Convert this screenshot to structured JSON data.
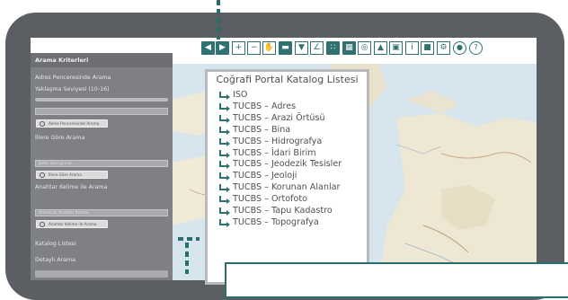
{
  "sidebar": {
    "header": "Arama Kriterleri",
    "address_label": "Adres Penceresinde Arama",
    "zoom_label": "Yaklaşma Seviyesi (10-16)",
    "address_button": "Adres Penceresinde Arama",
    "province_label": "İllere Göre Arama",
    "province_placeholder": "Şehir ismi giriniz...",
    "province_button": "İllere Göre Arama",
    "keyword_label": "Anahtar Kelime ile Arama",
    "keyword_placeholder": "Aranacak Anahtar Kelime",
    "keyword_button": "Anahtar Kelime ile Arama",
    "catalog_list_label": "Katalog Listesi",
    "detailed_search_label": "Detaylı Arama"
  },
  "toolbar": {
    "icons": [
      "arrow-left-icon",
      "arrow-right-icon",
      "zoom-in-icon",
      "zoom-out-icon",
      "pan-hand-icon",
      "car-icon",
      "location-pin-icon",
      "measure-angle-icon",
      "grid-icon",
      "layers-icon",
      "globe-icon",
      "north-arrow-icon",
      "print-icon",
      "info-icon",
      "bus-icon",
      "settings-icon",
      "user-icon",
      "help-icon"
    ]
  },
  "catalog": {
    "title": "Coğrafi Portal Katalog Listesi",
    "items": [
      "ISO",
      "TUCBS – Adres",
      "TUCBS – Arazi Örtüsü",
      "TUCBS –  Bina",
      "TUCBS – Hidrografya",
      "TUCBS – İdari Birim",
      "TUCBS – Jeodezik Tesisler",
      "TUCBS – Jeoloji",
      "TUCBS – Korunan Alanlar",
      "TUCBS –  Ortofoto",
      "TUCBS – Tapu Kadastro",
      "TUCBS – Topografya"
    ]
  },
  "colors": {
    "accent": "#2f7270",
    "frame": "#5b5e63",
    "sidebar": "#7e8084"
  }
}
